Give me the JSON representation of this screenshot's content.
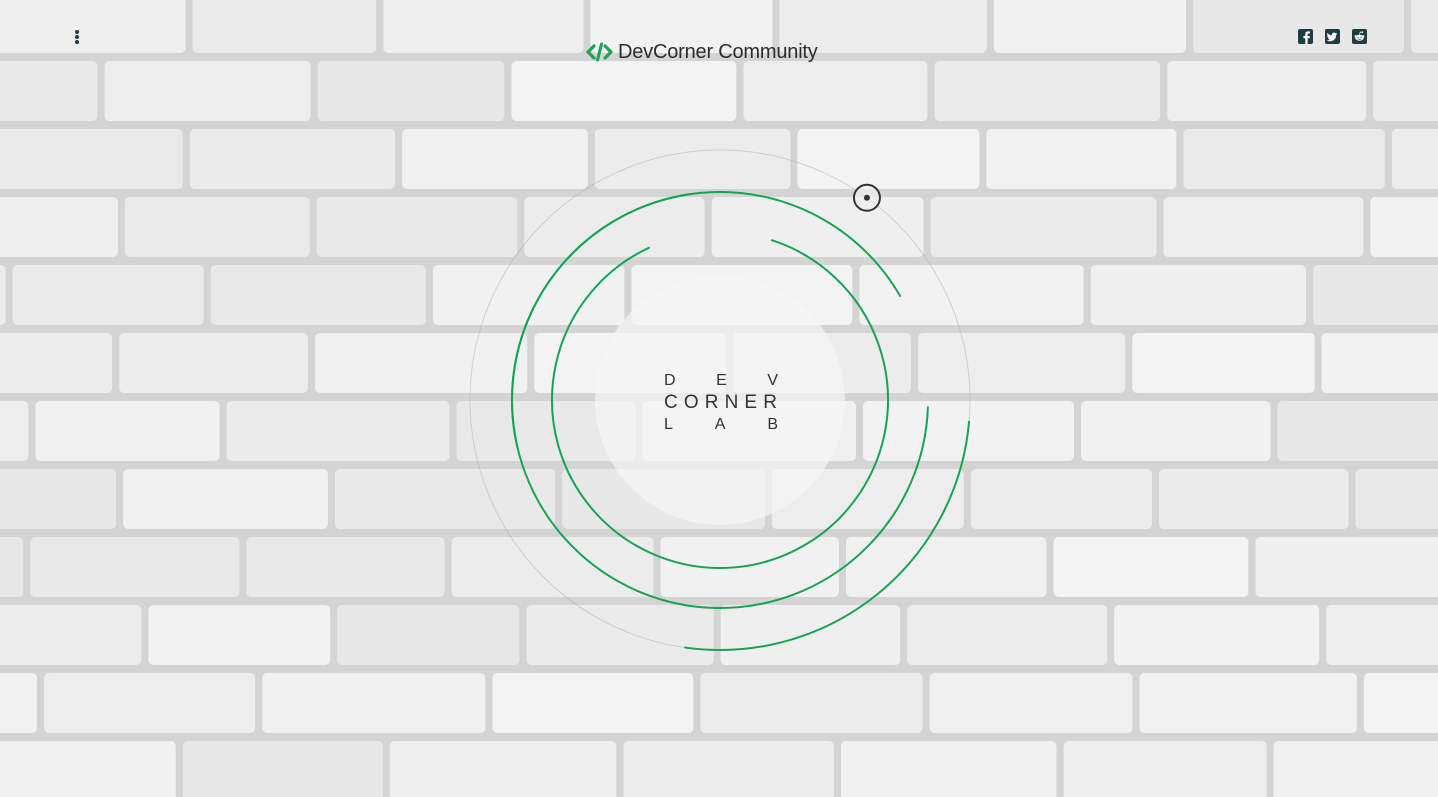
{
  "brand": {
    "name": "DevCorner Community",
    "icon": "code-brackets-icon",
    "accent_color": "#1aa45a"
  },
  "menu": {
    "icon": "vertical-ellipsis-icon"
  },
  "social_links": [
    {
      "name": "facebook",
      "icon": "facebook-icon"
    },
    {
      "name": "twitter",
      "icon": "twitter-icon"
    },
    {
      "name": "reddit",
      "icon": "reddit-icon"
    }
  ],
  "logo": {
    "line1": [
      "D",
      "E",
      "V"
    ],
    "line2": [
      "C",
      "O",
      "R",
      "N",
      "E",
      "R"
    ],
    "line3": [
      "L",
      "A",
      "B"
    ]
  },
  "target_icon": "target-dot-icon",
  "colors": {
    "ring": "#17a357",
    "icon_dark": "#1f3b44",
    "wall": "#e6e6e6"
  }
}
